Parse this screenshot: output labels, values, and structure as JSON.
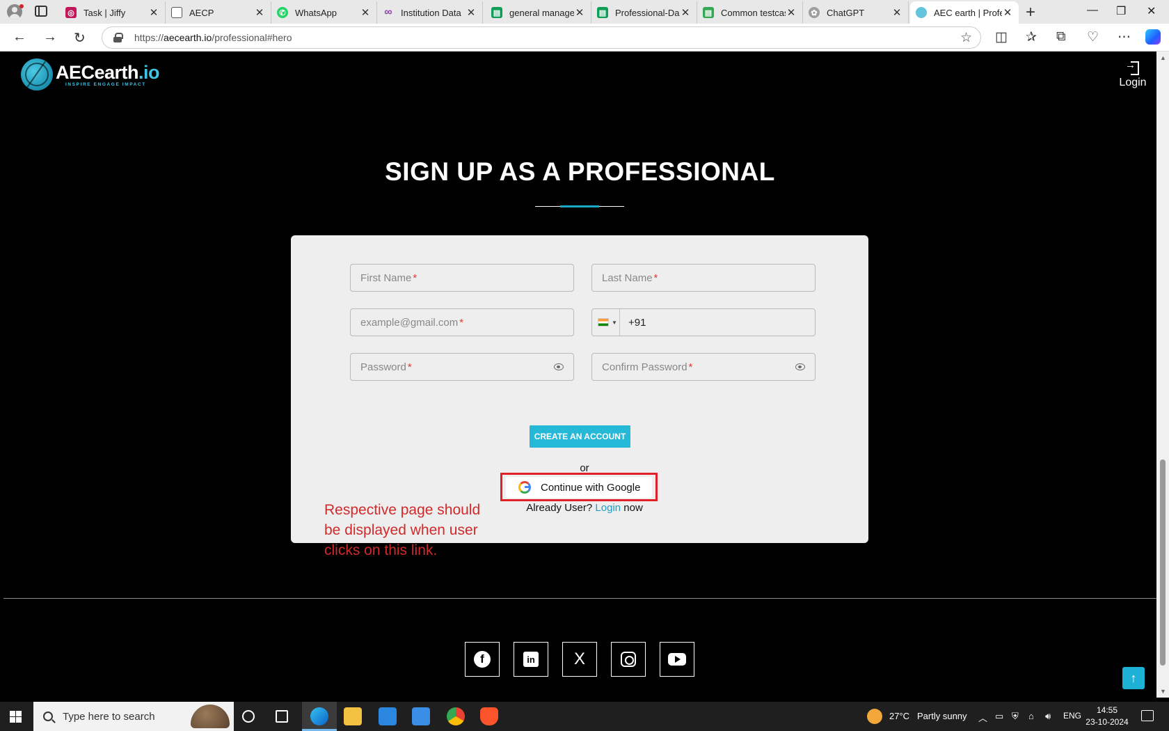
{
  "browser": {
    "tabs": [
      {
        "label": "Task | Jiffy",
        "icon": "fingerprint-icon",
        "color": "#c2185b"
      },
      {
        "label": "AECP",
        "icon": "document-icon",
        "color": "#555555"
      },
      {
        "label": "WhatsApp",
        "icon": "whatsapp-icon",
        "color": "#25d366"
      },
      {
        "label": "Institution Data",
        "icon": "infinity-icon",
        "color": "#8e44ad"
      },
      {
        "label": "general managem",
        "icon": "sheets-icon",
        "color": "#0f9d58"
      },
      {
        "label": "Professional-Dash",
        "icon": "sheets-icon",
        "color": "#0f9d58"
      },
      {
        "label": "Common testcase",
        "icon": "sheets-icon",
        "color": "#34a853"
      },
      {
        "label": "ChatGPT",
        "icon": "chatgpt-icon",
        "color": "#9e9e9e"
      },
      {
        "label": "AEC earth | Profe",
        "icon": "aec-icon",
        "color": "#63c5dd"
      }
    ],
    "new_tab": "+",
    "url_prefix": "https://",
    "url_host": "aecearth.io",
    "url_path": "/professional#hero"
  },
  "header": {
    "logo_name_main": "AECearth",
    "logo_name_suffix": ".io",
    "logo_tagline": "INSPIRE ENGAGE IMPACT",
    "login_label": "Login"
  },
  "form": {
    "title": "SIGN UP AS A PROFESSIONAL",
    "first_name_placeholder": "First Name",
    "last_name_placeholder": "Last Name",
    "email_placeholder": "example@gmail.com",
    "phone_value": "+91",
    "password_placeholder": "Password",
    "confirm_password_placeholder": "Confirm Password",
    "required_mark": "*",
    "create_button": "CREATE AN ACCOUNT",
    "or_text": "or",
    "google_button": "Continue with Google",
    "already_prefix": "Already User?",
    "already_link": "Login",
    "already_suffix": "now"
  },
  "annotation": {
    "text": "Respective page should be displayed when user clicks on this link.",
    "color": "#d12a2a"
  },
  "footer": {
    "social_icons": [
      "facebook-icon",
      "linkedin-icon",
      "x-icon",
      "instagram-icon",
      "youtube-icon"
    ],
    "linkedin_glyph": "in",
    "facebook_glyph": "f",
    "x_glyph": "X"
  },
  "taskbar": {
    "search_placeholder": "Type here to search",
    "weather": "27°C",
    "weather_desc": "Partly sunny",
    "lang": "ENG",
    "time": "14:55",
    "date": "23-10-2024"
  },
  "colors": {
    "accent": "#25b9d7",
    "highlight": "#e21f26"
  }
}
